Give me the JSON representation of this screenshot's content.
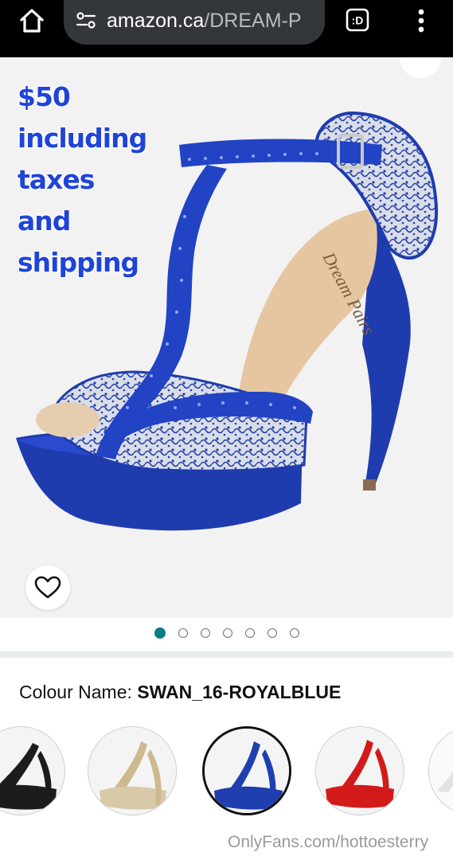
{
  "browser": {
    "url_host": "amazon.ca",
    "url_path": "/DREAM-P",
    "tabs_label": ":D",
    "icons": {
      "home": "home-icon",
      "site_info": "site-settings-icon",
      "tabs": "tab-switcher-icon",
      "menu": "more-vert-icon"
    }
  },
  "product_image": {
    "promo_lines": [
      "$50",
      "including",
      "taxes",
      "and",
      "shipping"
    ],
    "brand_print": "Dream Pairs",
    "wishlist_icon": "heart-outline-icon",
    "carousel": {
      "count": 7,
      "active_index": 0
    }
  },
  "colour": {
    "label": "Colour Name:",
    "value": "SWAN_16-ROYALBLUE",
    "swatches": [
      {
        "name": "Black",
        "color": "#1c1c1c",
        "selected": false
      },
      {
        "name": "Champagne",
        "color": "#d8c9a8",
        "selected": false
      },
      {
        "name": "Royal Blue",
        "color": "#1f3fae",
        "selected": true
      },
      {
        "name": "Red",
        "color": "#d21a1a",
        "selected": false
      },
      {
        "name": "White",
        "color": "#eeeeee",
        "selected": false
      }
    ]
  },
  "watermark": "OnlyFans.com/hottoesterry",
  "colors": {
    "topbar": "#000000",
    "urlbar": "#33373b",
    "accent_dot": "#077d85",
    "promo_text": "#1f44d8",
    "shoe_blue": "#1e3aa8"
  }
}
